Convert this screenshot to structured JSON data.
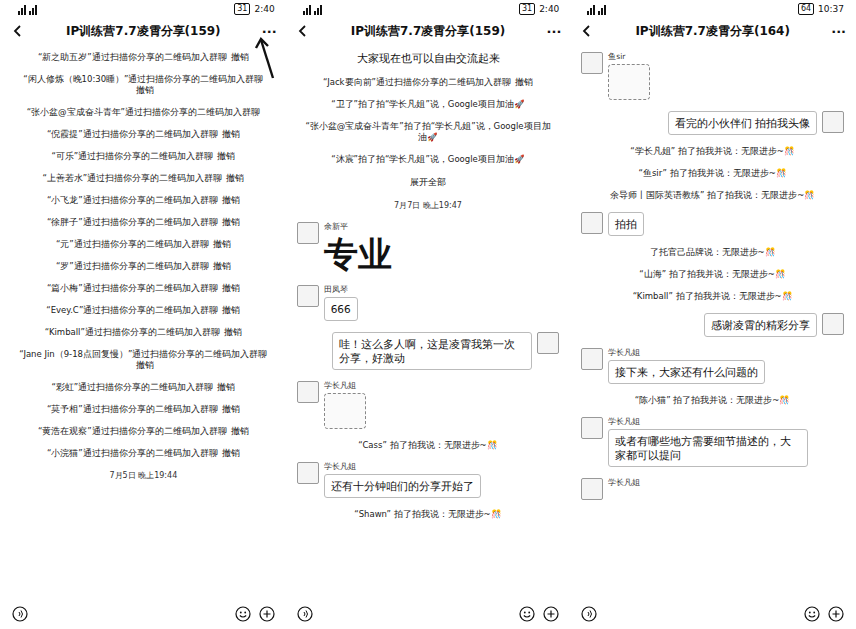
{
  "panels": [
    {
      "status": {
        "time": "2:40",
        "battery": "31"
      },
      "title": "IP训练营7.7凌霄分享(159)",
      "more": "···",
      "annotation_arrow": true,
      "messages": [
        {
          "kind": "system",
          "text": "“新之助五岁”通过扫描你分享的二维码加入群聊",
          "action": "撤销"
        },
        {
          "kind": "system",
          "text": "“闲人修炼（晚10:30睡）”通过扫描你分享的二维码加入群聊",
          "action": "撤销"
        },
        {
          "kind": "system",
          "text": "“张小盆@宝成奋斗青年”通过扫描你分享的二维码加入群聊",
          "action": ""
        },
        {
          "kind": "system",
          "text": "“倪霞提”通过扫描你分享的二维码加入群聊",
          "action": "撤销"
        },
        {
          "kind": "system",
          "text": "“可乐”通过扫描你分享的二维码加入群聊",
          "action": "撤销"
        },
        {
          "kind": "system",
          "text": "“上善若水”通过扫描你分享的二维码加入群聊",
          "action": "撤销"
        },
        {
          "kind": "system",
          "text": "“小飞龙”通过扫描你分享的二维码加入群聊",
          "action": "撤销"
        },
        {
          "kind": "system",
          "text": "“徐胖子”通过扫描你分享的二维码加入群聊",
          "action": "撤销"
        },
        {
          "kind": "system",
          "text": "“元”通过扫描你分享的二维码加入群聊",
          "action": "撤销"
        },
        {
          "kind": "system",
          "text": "“罗”通过扫描你分享的二维码加入群聊",
          "action": "撤销"
        },
        {
          "kind": "system",
          "text": "“篇小梅”通过扫描你分享的二维码加入群聊",
          "action": "撤销"
        },
        {
          "kind": "system",
          "text": "“Evey.C”通过扫描你分享的二维码加入群聊",
          "action": "撤销"
        },
        {
          "kind": "system",
          "text": "“Kimball”通过扫描你分享的二维码加入群聊",
          "action": "撤销"
        },
        {
          "kind": "system",
          "text": "“Jane Jin（9-18点回复慢）”通过扫描你分享的二维码加入群聊",
          "action": "撤销"
        },
        {
          "kind": "system",
          "text": "“彩虹”通过扫描你分享的二维码加入群聊",
          "action": "撤销"
        },
        {
          "kind": "system",
          "text": "“莫予相”通过扫描你分享的二维码加入群聊",
          "action": "撤销"
        },
        {
          "kind": "system",
          "text": "“黄浩在观察”通过扫描你分享的二维码加入群聊",
          "action": "撤销"
        },
        {
          "kind": "system",
          "text": "“小浣猫”通过扫描你分享的二维码加入群聊",
          "action": "撤销"
        },
        {
          "kind": "time",
          "text": "7月5日 晚上19:44"
        }
      ]
    },
    {
      "status": {
        "time": "2:40",
        "battery": "31"
      },
      "title": "IP训练营7.7凌霄分享(159)",
      "more": "···",
      "annotation_arrow": false,
      "messages": [
        {
          "kind": "notice",
          "text": "大家现在也可以自由交流起来"
        },
        {
          "kind": "system",
          "text": "“Jack要向前”通过扫描你分享的二维码加入群聊",
          "action": "撤销"
        },
        {
          "kind": "system",
          "text": "“卫了”拍了拍“学长凡姐”说，Google项目加油🚀",
          "action": ""
        },
        {
          "kind": "system",
          "text": "“张小盆@宝成奋斗青年”拍了拍“学长凡姐”说，Google项目加油🚀",
          "action": ""
        },
        {
          "kind": "system",
          "text": "“沐宸”拍了拍“学长凡姐”说，Google项目加油🚀",
          "action": ""
        },
        {
          "kind": "expand",
          "text": "展开全部"
        },
        {
          "kind": "time",
          "text": "7月7日 晚上19:47"
        },
        {
          "kind": "sticker-text",
          "side": "left",
          "sender": "余新平",
          "text": "专业"
        },
        {
          "kind": "bubble",
          "side": "left",
          "sender": "田凤琴",
          "text": "666"
        },
        {
          "kind": "bubble",
          "side": "right",
          "sender": "",
          "text": "哇！这么多人啊，这是凌霄我第一次分享，好激动"
        },
        {
          "kind": "sticker",
          "side": "left",
          "sender": "学长凡姐"
        },
        {
          "kind": "system",
          "text": "“Cass” 拍了拍我说：无限进步~🎊",
          "action": ""
        },
        {
          "kind": "bubble",
          "side": "left",
          "sender": "学长凡姐",
          "text": "还有十分钟咱们的分享开始了"
        },
        {
          "kind": "system",
          "text": "“Shawn” 拍了拍我说：无限进步~🎊",
          "action": ""
        }
      ]
    },
    {
      "status": {
        "time": "10:37",
        "battery": "64"
      },
      "title": "IP训练营7.7凌霄分享(164)",
      "more": "···",
      "annotation_arrow": false,
      "messages": [
        {
          "kind": "sticker",
          "side": "left",
          "sender": "鱼sir"
        },
        {
          "kind": "bubble",
          "side": "right",
          "sender": "",
          "text": "看完的小伙伴们 拍拍我头像"
        },
        {
          "kind": "system",
          "text": "“学长凡姐” 拍了拍我并说：无限进步~🎊",
          "action": ""
        },
        {
          "kind": "system",
          "text": "“鱼sir” 拍了拍我并说：无限进步~🎊",
          "action": ""
        },
        {
          "kind": "system",
          "text": "余导师丨国际英语教练” 拍了拍我说：无限进步~🎊",
          "action": ""
        },
        {
          "kind": "bubble",
          "side": "left",
          "sender": "",
          "text": "拍拍"
        },
        {
          "kind": "system",
          "text": "了托官己品牌说：无限进步~🎊",
          "action": ""
        },
        {
          "kind": "system",
          "text": "“山海” 拍了拍我并说：无限进步~🎊",
          "action": ""
        },
        {
          "kind": "system",
          "text": "“Kimball” 拍了拍我并说：无限进步~🎊",
          "action": ""
        },
        {
          "kind": "bubble",
          "side": "right",
          "sender": "",
          "text": "感谢凌霄的精彩分享"
        },
        {
          "kind": "bubble",
          "side": "left",
          "sender": "学长凡姐",
          "text": "接下来，大家还有什么问题的"
        },
        {
          "kind": "system",
          "text": "“陈小猫” 拍了拍我并说：无限进步~🎊",
          "action": ""
        },
        {
          "kind": "bubble",
          "side": "left",
          "sender": "学长凡姐",
          "text": "或者有哪些地方需要细节描述的，大家都可以提问"
        },
        {
          "kind": "sender-only",
          "side": "left",
          "sender": "学长凡姐"
        }
      ]
    }
  ]
}
